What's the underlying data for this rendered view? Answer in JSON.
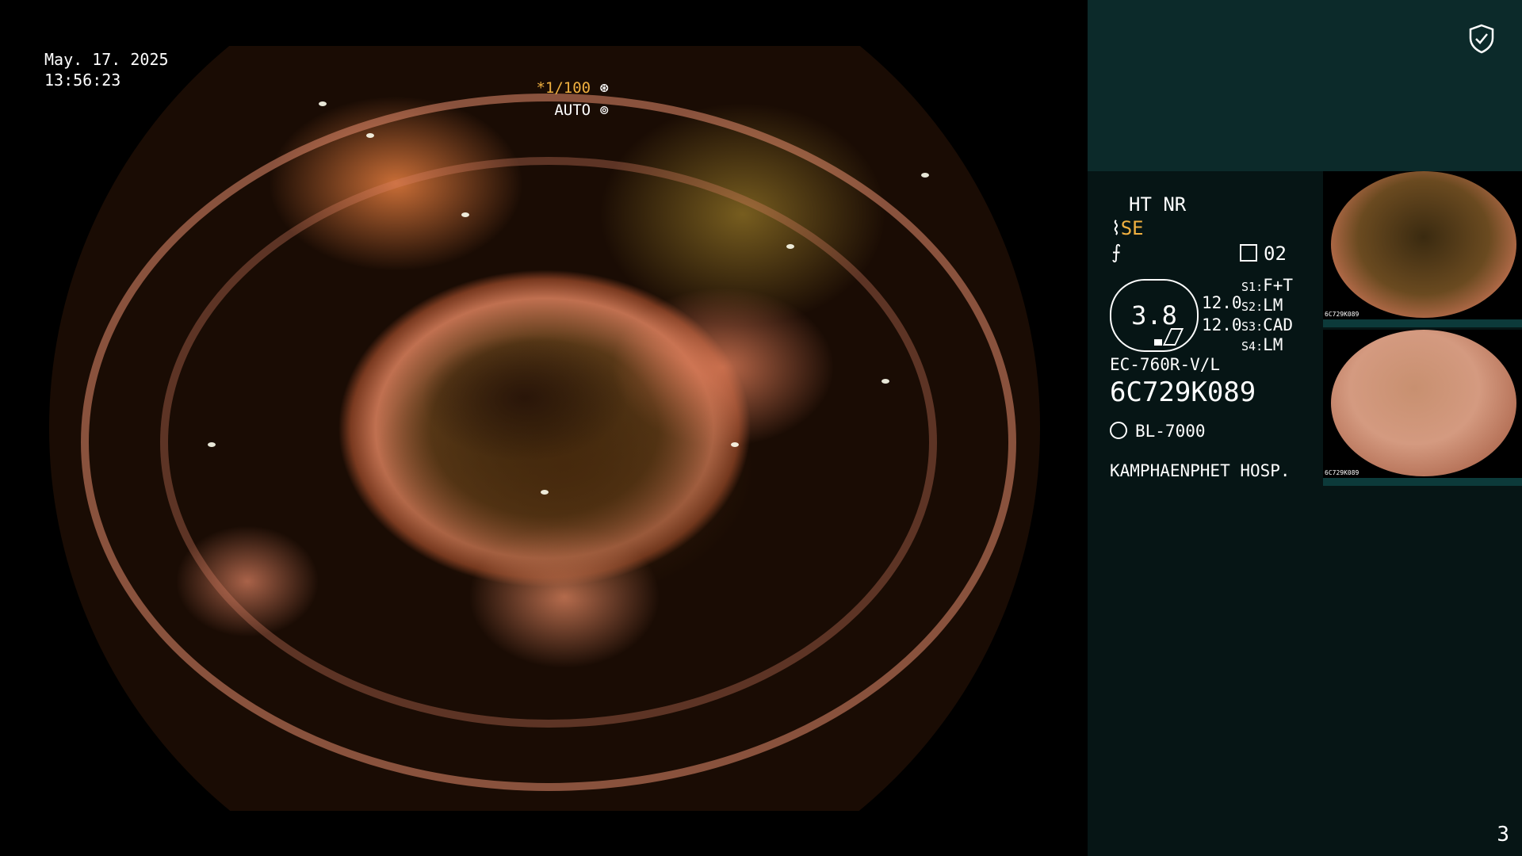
{
  "overlay": {
    "date": "May. 17. 2025",
    "time": "13:56:23",
    "shutter_prefix": "*",
    "shutter": "1/100",
    "iris": "AUTO"
  },
  "panel": {
    "mode": "HT NR",
    "enhance": "SE",
    "memo_count": "02",
    "gauge_value": "3.8",
    "readout_1": "12.0",
    "readout_2": "12.0",
    "switches": [
      {
        "key": "S1",
        "value": "F+T"
      },
      {
        "key": "S2",
        "value": "LM"
      },
      {
        "key": "S3",
        "value": "CAD"
      },
      {
        "key": "S4",
        "value": "LM"
      }
    ],
    "scope_model": "EC-760R-V/L",
    "scope_serial": "6C729K089",
    "light_source": "BL-7000",
    "hospital": "KAMPHAENPHET HOSP."
  },
  "thumbnails": [
    {
      "label": "6C729K089"
    },
    {
      "label": "6C729K089"
    }
  ],
  "page_number": "3",
  "colors": {
    "accent": "#f0b040",
    "panel_bg": "#061515",
    "panel_top_bg": "#0c2a2a"
  },
  "icons": [
    "shield-check-icon",
    "iris-icon",
    "memo-icon",
    "light-source-icon",
    "enhance-icon",
    "flash-icon"
  ]
}
